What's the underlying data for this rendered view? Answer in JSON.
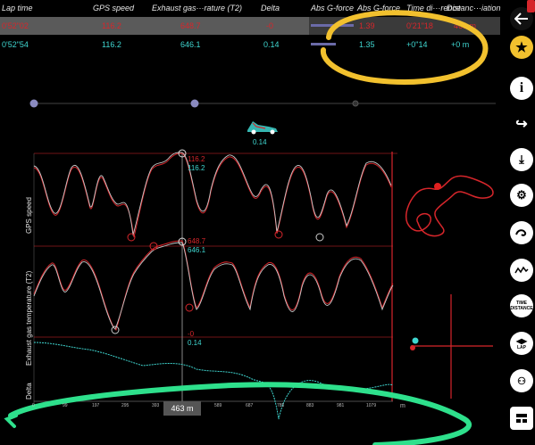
{
  "header": {
    "columns": [
      "Lap time",
      "GPS speed",
      "Exhaust gas···rature (T2)",
      "Delta",
      "Abs G-force",
      "Abs G-force",
      "Time di···rence",
      "Distanc···iation"
    ]
  },
  "rows": [
    {
      "lap_time": "0'52\"02",
      "gps_speed": "116.2",
      "exhaust": "648.7",
      "delta": "-0",
      "g1": "",
      "g2": "1.39",
      "time_diff": "0'21\"18",
      "dist": "463 m"
    },
    {
      "lap_time": "0'52\"54",
      "gps_speed": "116.2",
      "exhaust": "646.1",
      "delta": "0.14",
      "g1": "",
      "g2": "1.35",
      "time_diff": "+0\"14",
      "dist": "+0 m"
    }
  ],
  "car_label": "0.14",
  "charts": {
    "gps": {
      "label": "GPS speed",
      "red_value": "116.2",
      "cyan_value": "116.2"
    },
    "exhaust": {
      "label": "Exhaust gas temperature (T2)",
      "red_value": "648.7",
      "cyan_value": "646.1"
    },
    "delta": {
      "label": "Delta",
      "red_value": "-0",
      "cyan_value": "0.14"
    }
  },
  "x_ticks": [
    "0",
    "99",
    "197",
    "295",
    "393",
    "491",
    "589",
    "687",
    "785",
    "883",
    "981",
    "1079"
  ],
  "x_unit": "m",
  "cursor_position": "463 m",
  "sidebar": {
    "time_distance_label": "TIME\nDISTANCE",
    "lap_label": "LAP"
  },
  "colors": {
    "reference": "#d6262b",
    "current": "#3fd6d0",
    "annotation_yellow": "#f2c12e",
    "annotation_green": "#2ee08c"
  }
}
